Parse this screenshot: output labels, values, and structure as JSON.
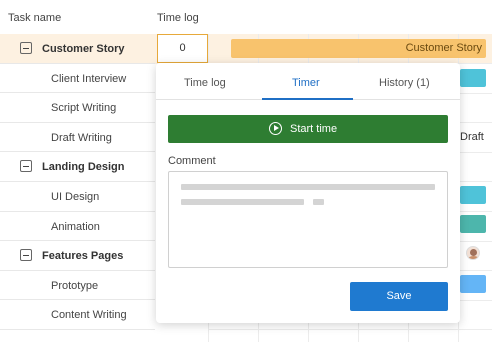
{
  "header": {
    "task_name": "Task name",
    "time_log": "Time log"
  },
  "rows": [
    {
      "label": "Customer Story",
      "group": true
    },
    {
      "label": "Client Interview",
      "group": false
    },
    {
      "label": "Script Writing",
      "group": false
    },
    {
      "label": "Draft Writing",
      "group": false
    },
    {
      "label": "Landing Design",
      "group": true
    },
    {
      "label": "UI Design",
      "group": false
    },
    {
      "label": "Animation",
      "group": false
    },
    {
      "label": "Features Pages",
      "group": true
    },
    {
      "label": "Prototype",
      "group": false
    },
    {
      "label": "Content Writing",
      "group": false
    }
  ],
  "time_value": "0",
  "gantt": {
    "bar_label": "Customer Story",
    "draft_label": "Draft"
  },
  "popup": {
    "tabs": [
      {
        "label": "Time log"
      },
      {
        "label": "Timer"
      },
      {
        "label": "History (1)"
      }
    ],
    "start_button": "Start time",
    "comment_label": "Comment",
    "save_button": "Save"
  },
  "colors": {
    "bar": "#f8c36d",
    "teal": "#4fc3d9",
    "teal_dark": "#4db6ac",
    "blue": "#64b5f6",
    "start": "#2e7d32",
    "save": "#1f7ad0",
    "highlight": "#fdf1e1"
  }
}
